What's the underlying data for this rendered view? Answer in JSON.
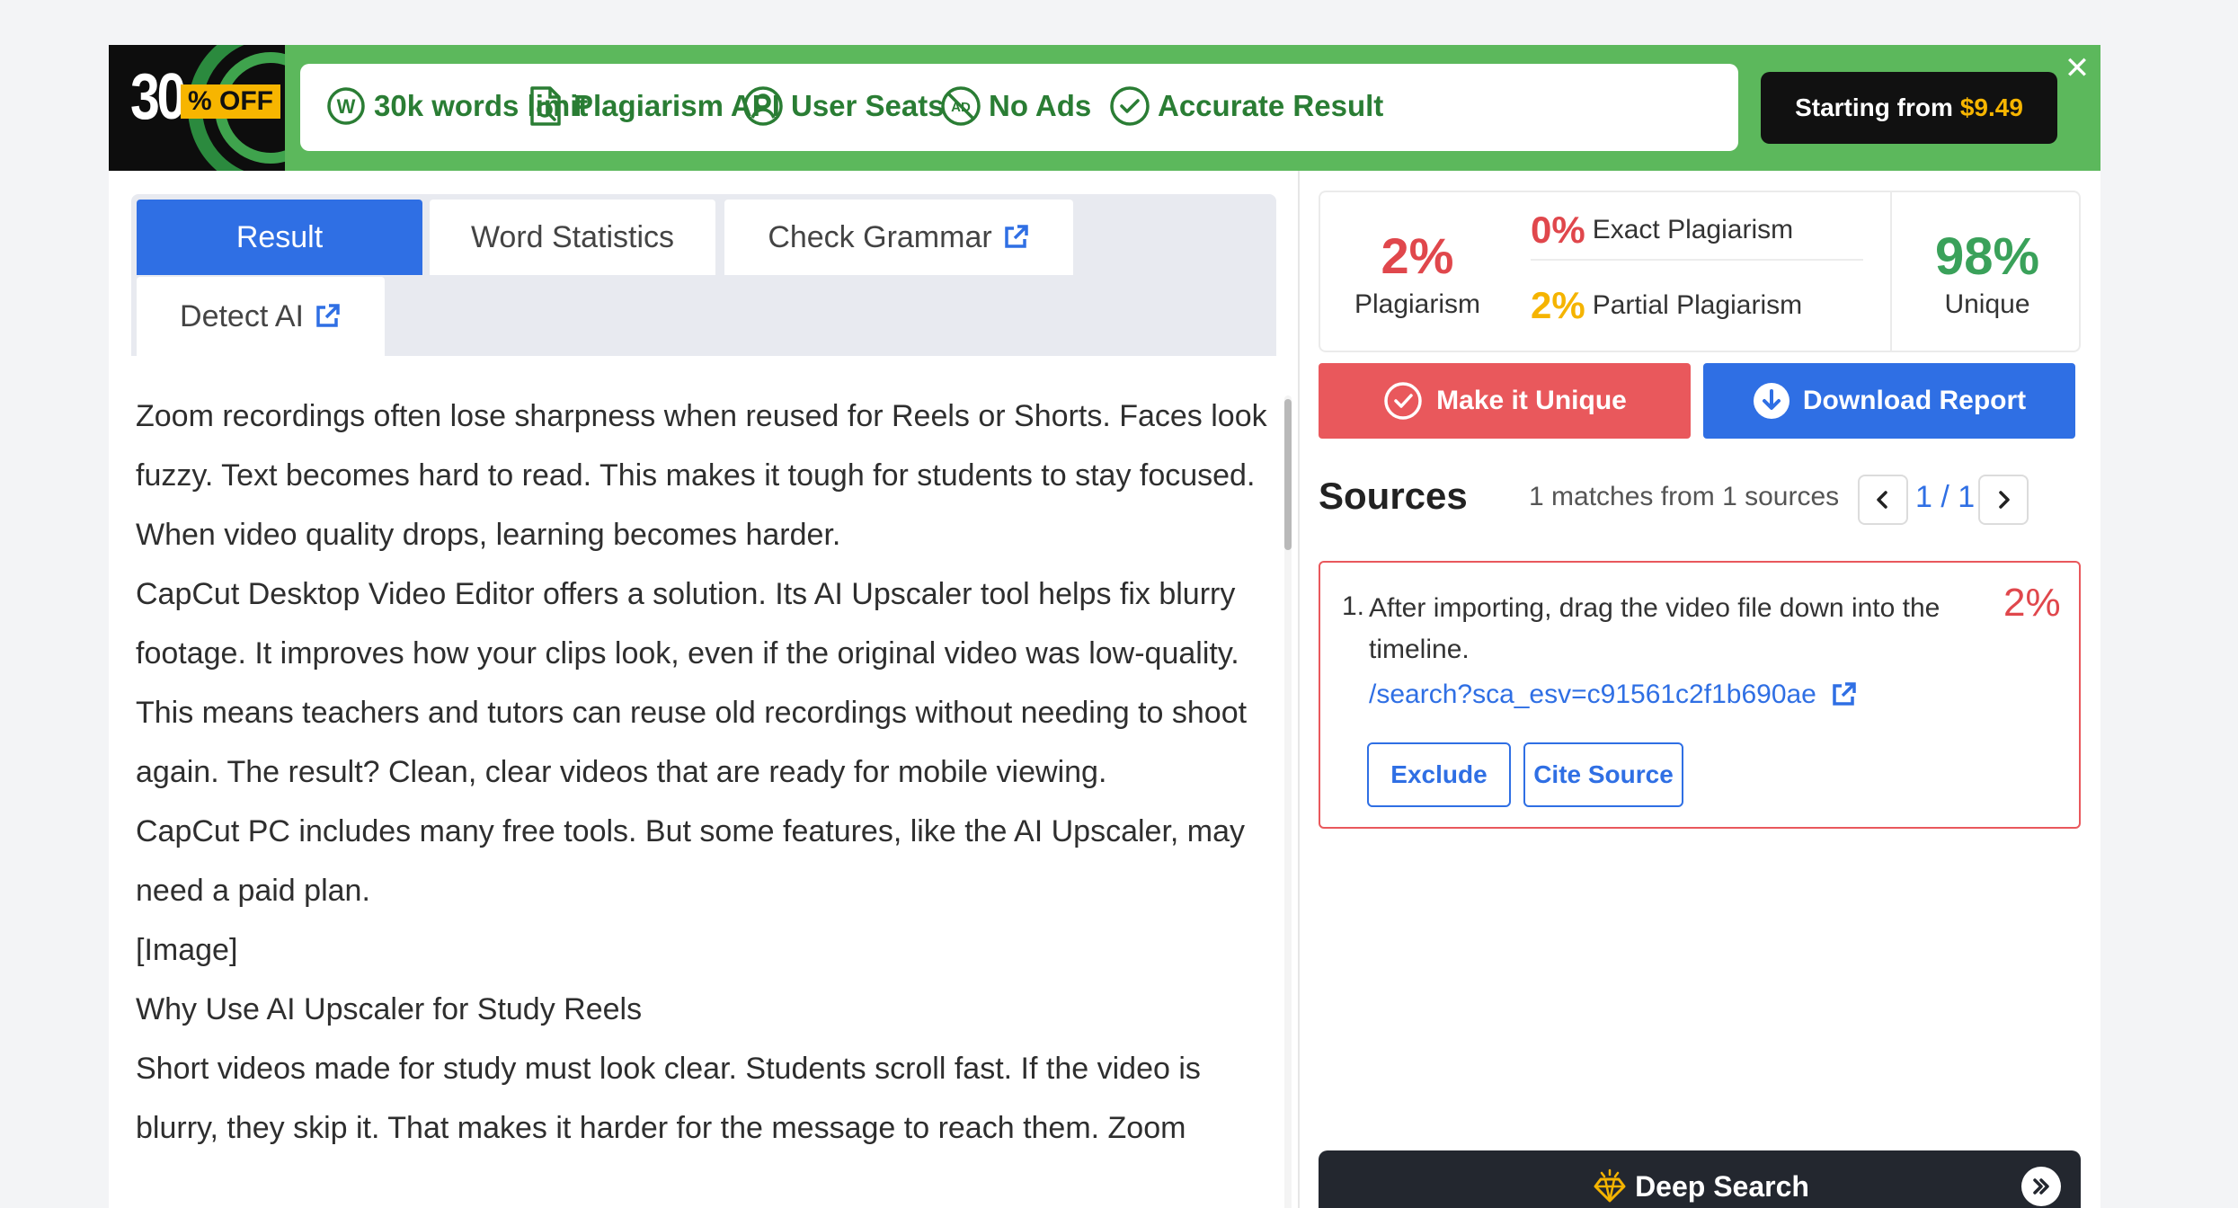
{
  "banner": {
    "discount_number": "30",
    "discount_suffix": "% OFF",
    "features": [
      {
        "label": "30k words limit",
        "icon": "w-circle-icon"
      },
      {
        "label": "Plagiarism API",
        "icon": "document-search-icon"
      },
      {
        "label": "User Seats",
        "icon": "user-circle-icon"
      },
      {
        "label": "No Ads",
        "icon": "no-ads-icon"
      },
      {
        "label": "Accurate Result",
        "icon": "check-circle-icon"
      }
    ],
    "cta_label": "Starting from",
    "cta_price": "$9.49",
    "close_glyph": "✕"
  },
  "tabs": [
    {
      "label": "Result",
      "active": true
    },
    {
      "label": "Word Statistics",
      "active": false
    },
    {
      "label": "Check Grammar",
      "active": false
    },
    {
      "label": "Detect AI",
      "active": false
    }
  ],
  "content": {
    "paragraphs": [
      "Zoom recordings often lose sharpness when reused for Reels or Shorts. Faces look fuzzy. Text becomes hard to read. This makes it tough for students to stay focused. When video quality drops, learning becomes harder.",
      "CapCut Desktop Video Editor offers a solution. Its AI Upscaler tool helps fix blurry footage. It improves how your clips look, even if the original video was low-quality.",
      "This means teachers and tutors can reuse old recordings without needing to shoot again. The result? Clean, clear videos that are ready for mobile viewing.",
      "CapCut PC includes many free tools. But some features, like the AI Upscaler, may need a paid plan.",
      "[Image]",
      "Why Use AI Upscaler for Study Reels",
      "Short videos made for study must look clear. Students scroll fast. If the video is blurry, they skip it. That makes it harder for the message to reach them. Zoom"
    ]
  },
  "stats": {
    "plagiarism_pct": "2%",
    "plagiarism_label": "Plagiarism",
    "exact_pct": "0%",
    "exact_label": "Exact Plagiarism",
    "partial_pct": "2%",
    "partial_label": "Partial Plagiarism",
    "unique_pct": "98%",
    "unique_label": "Unique"
  },
  "actions": {
    "make_unique": "Make it Unique",
    "download_report": "Download Report"
  },
  "sources": {
    "title": "Sources",
    "count_text": "1 matches from 1 sources",
    "page_current": "1",
    "page_sep": "/",
    "page_total": "1",
    "items": [
      {
        "number": "1.",
        "text": "After importing, drag the video file down into the timeline.",
        "percent": "2%",
        "url": "/search?sca_esv=c91561c2f1b690ae",
        "exclude_label": "Exclude",
        "cite_label": "Cite Source"
      }
    ]
  },
  "deep_search": {
    "label": "Deep Search"
  },
  "colors": {
    "brand_blue": "#2f6fe4",
    "danger_red": "#e9585c",
    "banner_green": "#5cb85c",
    "warning_yellow": "#f5b400",
    "success_green": "#3aa15a"
  }
}
